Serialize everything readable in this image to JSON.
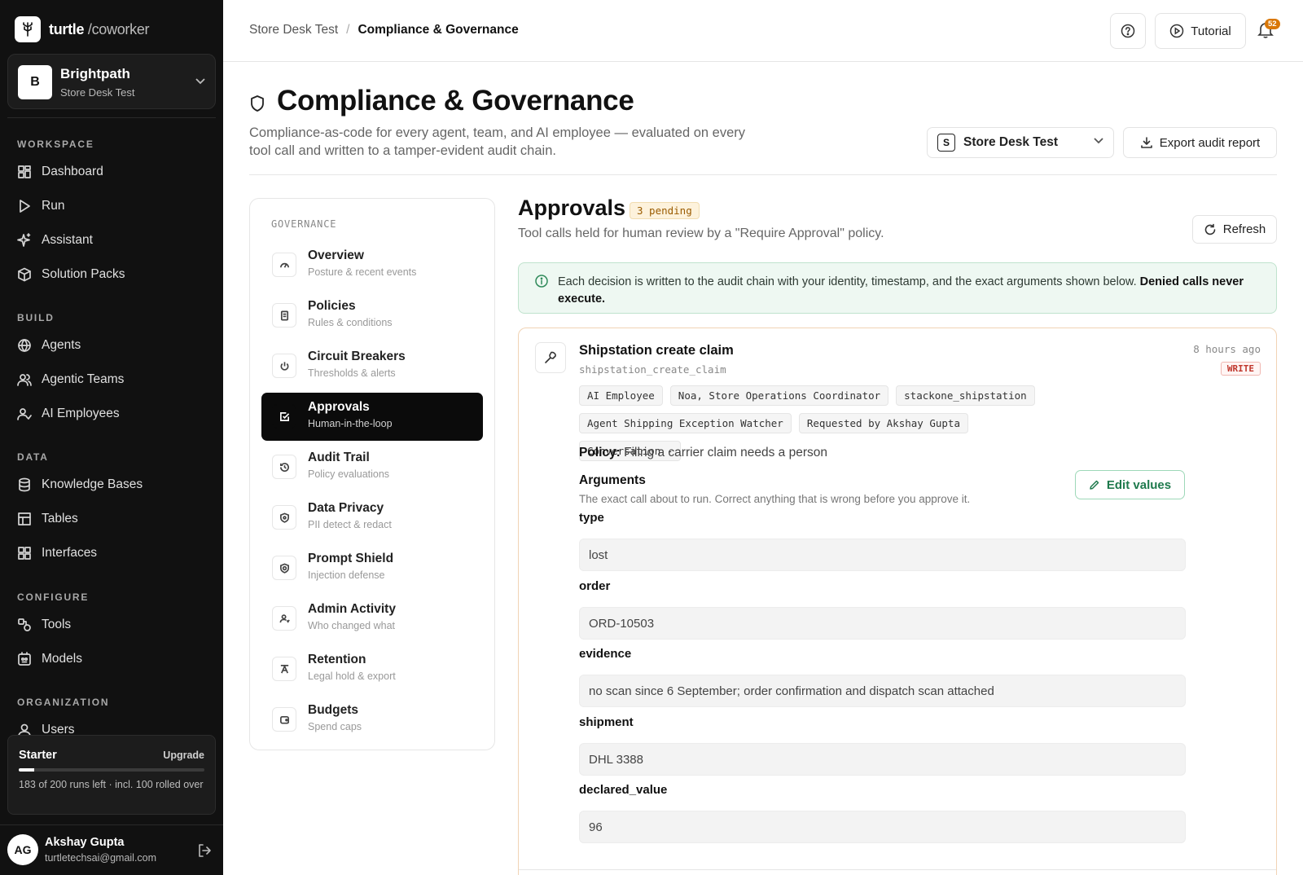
{
  "app": {
    "logo_main": "turtle",
    "logo_sub": "/coworker"
  },
  "workspace": {
    "avatar": "B",
    "name": "Brightpath",
    "sub": "Store Desk Test"
  },
  "sidebar": {
    "sections": [
      {
        "title": "WORKSPACE",
        "items": [
          {
            "label": "Dashboard",
            "icon": "dashboard-icon"
          },
          {
            "label": "Run",
            "icon": "play-icon"
          },
          {
            "label": "Assistant",
            "icon": "sparkle-icon"
          },
          {
            "label": "Solution Packs",
            "icon": "package-icon"
          }
        ]
      },
      {
        "title": "BUILD",
        "items": [
          {
            "label": "Agents",
            "icon": "globe-icon"
          },
          {
            "label": "Agentic Teams",
            "icon": "team-icon"
          },
          {
            "label": "AI Employees",
            "icon": "user-check-icon"
          }
        ]
      },
      {
        "title": "DATA",
        "items": [
          {
            "label": "Knowledge Bases",
            "icon": "database-icon"
          },
          {
            "label": "Tables",
            "icon": "table-icon"
          },
          {
            "label": "Interfaces",
            "icon": "layout-icon"
          }
        ]
      },
      {
        "title": "CONFIGURE",
        "items": [
          {
            "label": "Tools",
            "icon": "tools-icon"
          },
          {
            "label": "Models",
            "icon": "model-icon"
          }
        ]
      },
      {
        "title": "ORGANIZATION",
        "items": [
          {
            "label": "Users",
            "icon": "user-icon"
          }
        ]
      }
    ]
  },
  "plan": {
    "name": "Starter",
    "upgrade": "Upgrade",
    "usage_fraction": 0.085,
    "text": "183 of 200 runs left · incl. 100 rolled over"
  },
  "user": {
    "initials": "AG",
    "name": "Akshay Gupta",
    "email": "turtletechsai@gmail.com"
  },
  "topbar": {
    "crumb_parent": "Store Desk Test",
    "crumb_sep": "/",
    "crumb_current": "Compliance & Governance",
    "tutorial": "Tutorial",
    "notification_count": "52"
  },
  "page": {
    "title": "Compliance & Governance",
    "description": "Compliance-as-code for every agent, team, and AI employee — evaluated on every tool call and written to a tamper-evident audit chain.",
    "store_initial": "S",
    "store_select": "Store Desk Test",
    "export": "Export audit report"
  },
  "governance": {
    "heading": "GOVERNANCE",
    "items": [
      {
        "title": "Overview",
        "sub": "Posture & recent events",
        "icon": "gauge-icon",
        "active": false
      },
      {
        "title": "Policies",
        "sub": "Rules & conditions",
        "icon": "document-icon",
        "active": false
      },
      {
        "title": "Circuit Breakers",
        "sub": "Thresholds & alerts",
        "icon": "power-icon",
        "active": false
      },
      {
        "title": "Approvals",
        "sub": "Human-in-the-loop",
        "icon": "check-square-icon",
        "active": true
      },
      {
        "title": "Audit Trail",
        "sub": "Policy evaluations",
        "icon": "history-icon",
        "active": false
      },
      {
        "title": "Data Privacy",
        "sub": "PII detect & redact",
        "icon": "shield-dot-icon",
        "active": false
      },
      {
        "title": "Prompt Shield",
        "sub": "Injection defense",
        "icon": "shield-target-icon",
        "active": false
      },
      {
        "title": "Admin Activity",
        "sub": "Who changed what",
        "icon": "user-activity-icon",
        "active": false
      },
      {
        "title": "Retention",
        "sub": "Legal hold & export",
        "icon": "archive-icon",
        "active": false
      },
      {
        "title": "Budgets",
        "sub": "Spend caps",
        "icon": "wallet-icon",
        "active": false
      }
    ]
  },
  "approvals": {
    "title": "Approvals",
    "pending": "3 pending",
    "subtitle": "Tool calls held for human review by a \"Require Approval\" policy.",
    "refresh": "Refresh",
    "info_text": "Each decision is written to the audit chain with your identity, timestamp, and the exact arguments shown below.",
    "info_bold": "Denied calls never execute."
  },
  "card": {
    "tool_name": "Shipstation create claim",
    "tool_id": "shipstation_create_claim",
    "time_ago": "8 hours ago",
    "badge": "WRITE",
    "chips": [
      "AI Employee",
      "Noa, Store Operations Coordinator",
      "stackone_shipstation",
      "Agent Shipping Exception Watcher",
      "Requested by Akshay Gupta",
      "Conversation -"
    ],
    "policy_label": "Policy:",
    "policy_text": "Filing a carrier claim needs a person",
    "arguments_title": "Arguments",
    "arguments_sub": "The exact call about to run. Correct anything that is wrong before you approve it.",
    "edit_values": "Edit values",
    "fields": [
      {
        "label": "type",
        "value": "lost"
      },
      {
        "label": "order",
        "value": "ORD-10503"
      },
      {
        "label": "evidence",
        "value": "no scan since 6 September; order confirmation and dispatch scan attached"
      },
      {
        "label": "shipment",
        "value": "DHL 3388"
      },
      {
        "label": "declared_value",
        "value": "96"
      }
    ]
  }
}
